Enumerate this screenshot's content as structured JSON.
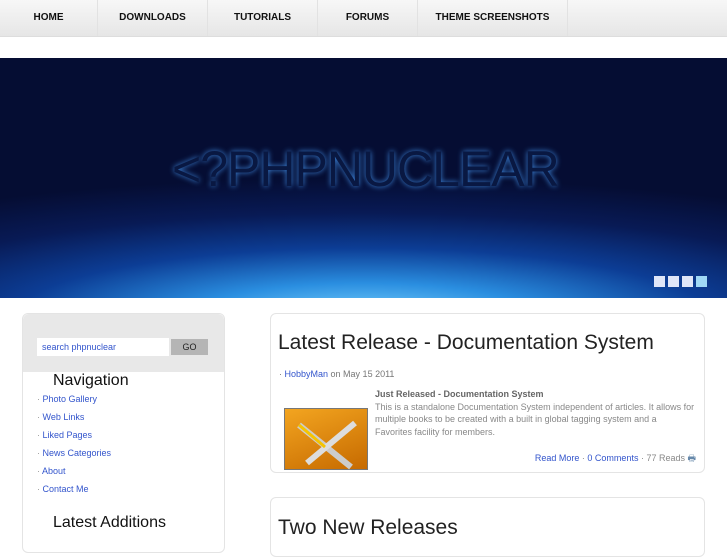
{
  "nav": [
    "HOME",
    "DOWNLOADS",
    "TUTORIALS",
    "FORUMS",
    "THEME SCREENSHOTS"
  ],
  "banner": {
    "logo": "<?PHPNUCLEAR"
  },
  "search": {
    "placeholder": "search phpnuclear",
    "go": "GO"
  },
  "sidebar": {
    "nav_title": "Navigation",
    "items": [
      "Photo Gallery",
      "Web Links",
      "Liked Pages",
      "News Categories",
      "About",
      "Contact Me"
    ],
    "latest_title": "Latest Additions"
  },
  "articles": [
    {
      "title": "Latest Release - Documentation System",
      "author": "HobbyMan",
      "date": "on May 15 2011",
      "subtitle": "Just Released - Documentation System",
      "text": "This is a standalone Documentation System independent of articles. It allows for multiple books to be created with a built in global tagging system and a Favorites facility for members.",
      "read_more": "Read More",
      "comments": "0 Comments",
      "reads": "77 Reads"
    },
    {
      "title": "Two New Releases"
    }
  ]
}
